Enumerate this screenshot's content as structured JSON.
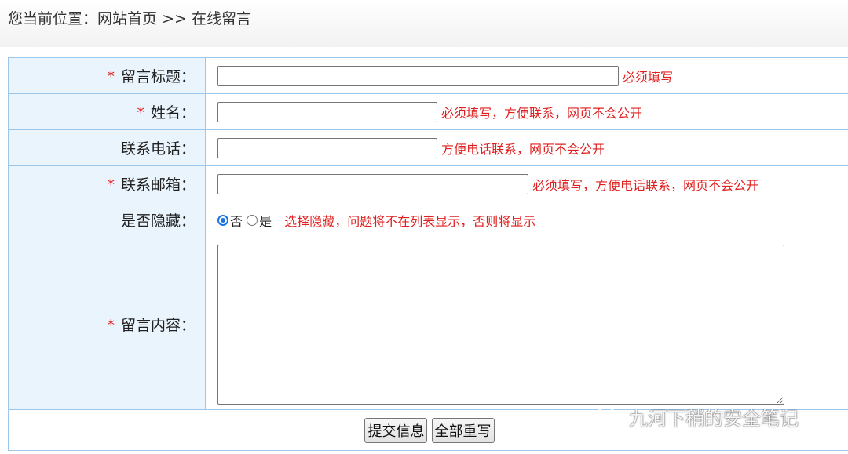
{
  "breadcrumb": {
    "prefix": "您当前位置：",
    "home": "网站首页",
    "separator": " >> ",
    "current": "在线留言"
  },
  "form": {
    "required_mark": "*",
    "title": {
      "label": "留言标题：",
      "value": "",
      "hint": "必须填写"
    },
    "name": {
      "label": "姓名：",
      "value": "",
      "hint": "必须填写，方便联系，网页不会公开"
    },
    "phone": {
      "label": "联系电话：",
      "value": "",
      "hint": "方便电话联系，网页不会公开"
    },
    "email": {
      "label": "联系邮箱：",
      "value": "",
      "hint": "必须填写，方便电话联系，网页不会公开"
    },
    "hidden": {
      "label": "是否隐藏：",
      "options": [
        {
          "label": "否",
          "selected": true
        },
        {
          "label": "是",
          "selected": false
        }
      ],
      "hint": "选择隐藏，问题将不在列表显示，否则将显示"
    },
    "content": {
      "label": "留言内容：",
      "value": ""
    }
  },
  "buttons": {
    "submit": "提交信息",
    "reset": "全部重写"
  },
  "watermark": {
    "text": "九河下稍的安全笔记",
    "icon": "wechat-icon"
  },
  "colors": {
    "required": "#e02020",
    "label_bg": "#eaf4fc",
    "border": "#9cc6ea",
    "radio_on": "#1a73e8"
  }
}
